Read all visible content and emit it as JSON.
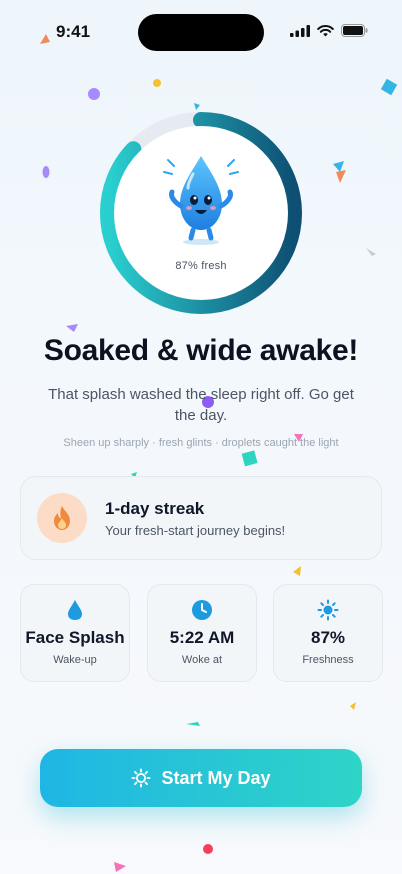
{
  "status_bar": {
    "time": "9:41"
  },
  "progress": {
    "label": "87% fresh",
    "value": 0.87,
    "colors": {
      "start": "#2ad0d0",
      "end": "#0e4f73",
      "track": "#e6ebf1"
    }
  },
  "headline": "Soaked & wide awake!",
  "subtitle": "That splash washed the sleep right off. Go get the day.",
  "tagline": "Sheen up sharply · fresh glints · droplets caught the light",
  "streak": {
    "title": "1-day streak",
    "subtitle": "Your fresh-start journey begins!",
    "icon": "flame-icon"
  },
  "stats": [
    {
      "icon": "water-drop-icon",
      "value": "Face Splash",
      "label": "Wake-up"
    },
    {
      "icon": "clock-icon",
      "value": "5:22 AM",
      "label": "Woke at"
    },
    {
      "icon": "sun-icon",
      "value": "87%",
      "label": "Freshness"
    }
  ],
  "cta": {
    "label": "Start My Day",
    "icon": "sun-icon"
  },
  "colors": {
    "accent": "#1fb6e4",
    "accent2": "#2fd4c7",
    "flame": "#f08a3c"
  }
}
